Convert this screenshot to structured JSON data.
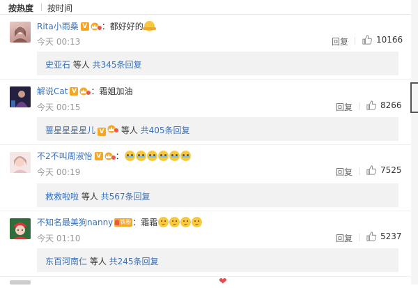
{
  "sort": {
    "hot": "按热度",
    "time": "按时间"
  },
  "comments": [
    {
      "user": "Rita小雨桑",
      "text": "：都好好的",
      "time": "今天 00:13",
      "reply_label": "回复",
      "likes": "10166",
      "replies": {
        "name": "史亚石",
        "suffix": " 等人 ",
        "link": "共345条回复"
      }
    },
    {
      "user": "解说Cat",
      "text": "：霜姐加油",
      "time": "今天 00:15",
      "reply_label": "回复",
      "likes": "8266",
      "replies": {
        "name": "蔷星星星星儿",
        "suffix": " 等人 ",
        "link": "共405条回复"
      }
    },
    {
      "user": "不2不叫周淑怡",
      "text": "：",
      "time": "今天 00:19",
      "reply_label": "回复",
      "likes": "7525",
      "replies": {
        "name": "救救啦啦",
        "suffix": " 等人 ",
        "link": "共567条回复"
      }
    },
    {
      "user": "不知名最美狗nanny",
      "fan_badge": "铁粉",
      "text": "：霜霜",
      "time": "今天 01:10",
      "reply_label": "回复",
      "likes": "5237",
      "replies": {
        "name": "东百河南仁",
        "suffix": " 等人 ",
        "link": "共245条回复"
      }
    }
  ],
  "icons": {
    "like": "thumbs-up-icon",
    "verified": "verified-v-icon",
    "vip": "vip-crown-icon"
  },
  "colors": {
    "username": "#3a71b8",
    "badge": "#f5a623",
    "reply_bg": "#f2f2f2"
  }
}
